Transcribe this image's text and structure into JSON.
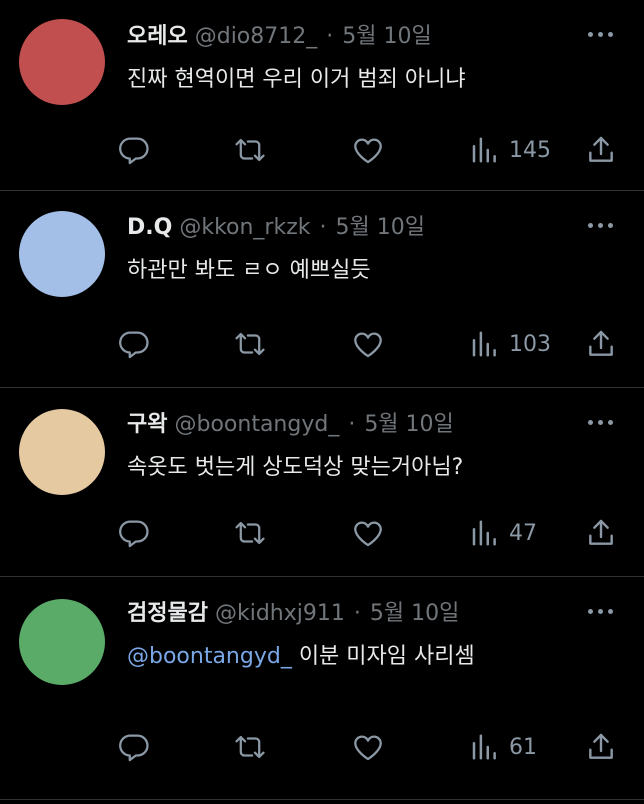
{
  "tweets": [
    {
      "name": "오레오",
      "handle": "@dio8712_",
      "separator": "·",
      "date": "5월 10일",
      "text": "진짜 현역이면 우리 이거 범죄 아니냐",
      "mention": "",
      "views": "145",
      "avatar_color": "#c24f50"
    },
    {
      "name": "D.Q",
      "handle": "@kkon_rkzk",
      "separator": "·",
      "date": "5월 10일",
      "text": "하관만 봐도 ㄹㅇ 예쁘실듯",
      "mention": "",
      "views": "103",
      "avatar_color": "#a3bfe8"
    },
    {
      "name": "구왁",
      "handle": "@boontangyd_",
      "separator": "·",
      "date": "5월 10일",
      "text": "속옷도 벗는게 상도덕상 맞는거아님?",
      "mention": "",
      "views": "47",
      "avatar_color": "#e5c9a0"
    },
    {
      "name": "검정물감",
      "handle": "@kidhxj911",
      "separator": "·",
      "date": "5월 10일",
      "text": " 이분 미자임 사리셈",
      "mention": "@boontangyd_",
      "views": "61",
      "avatar_color": "#5aaa68"
    }
  ],
  "icons": {
    "reply": "reply-icon",
    "retweet": "retweet-icon",
    "like": "heart-icon",
    "views": "views-icon",
    "share": "share-icon",
    "more": "more-icon"
  },
  "colors": {
    "background": "#000000",
    "primary_text": "#e7e9ea",
    "secondary_text": "#71767b",
    "icon": "#8b98a5",
    "mention": "#7aa7e6",
    "divider": "#2f3336"
  }
}
